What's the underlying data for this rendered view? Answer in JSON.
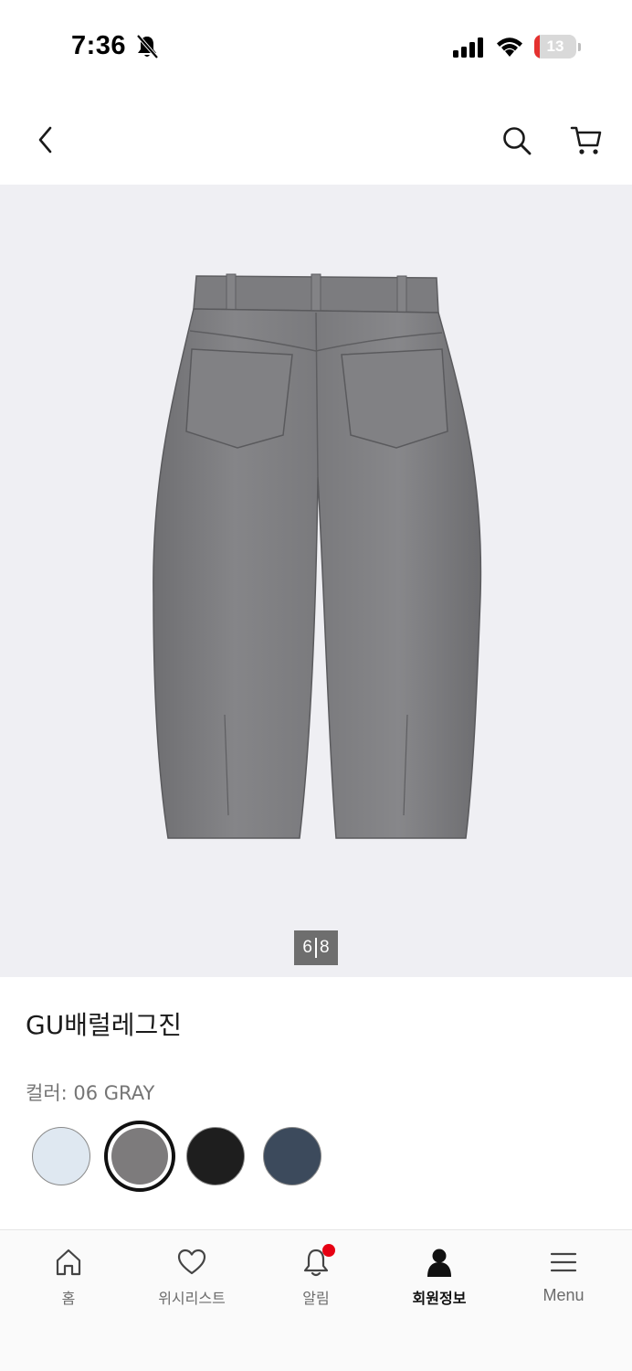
{
  "status_bar": {
    "time": "7:36",
    "battery_level": "13",
    "battery_fraction": 0.13,
    "icons": [
      "bell-slash-icon",
      "cellular-signal-icon",
      "wifi-icon",
      "battery-icon"
    ]
  },
  "header": {
    "icons": [
      "chevron-left-icon",
      "search-icon",
      "cart-icon"
    ]
  },
  "gallery": {
    "current_page": "6",
    "total_pages": "8",
    "image": "gray-barrel-jeans-back-view"
  },
  "product": {
    "title": "GU배럴레그진",
    "color_label": "컬러: 06 GRAY",
    "swatches": [
      {
        "name": "light-blue",
        "color": "#dfe8f1",
        "selected": false
      },
      {
        "name": "gray",
        "color": "#7d7b7c",
        "selected": true
      },
      {
        "name": "black",
        "color": "#1e1e1e",
        "selected": false
      },
      {
        "name": "navy-denim",
        "color": "#3c4a5c",
        "selected": false
      }
    ]
  },
  "tab_bar": {
    "tabs": [
      {
        "label": "홈",
        "icon": "home-icon",
        "active": false
      },
      {
        "label": "위시리스트",
        "icon": "heart-icon",
        "active": false
      },
      {
        "label": "알림",
        "icon": "bell-icon",
        "active": false,
        "badge": true
      },
      {
        "label": "회원정보",
        "icon": "user-icon",
        "active": true
      },
      {
        "label": "Menu",
        "icon": "hamburger-menu-icon",
        "active": false
      }
    ]
  },
  "colors": {
    "gallery_bg": "#efeff3",
    "badge_red": "#e60012",
    "battery_red": "#e5312f"
  }
}
